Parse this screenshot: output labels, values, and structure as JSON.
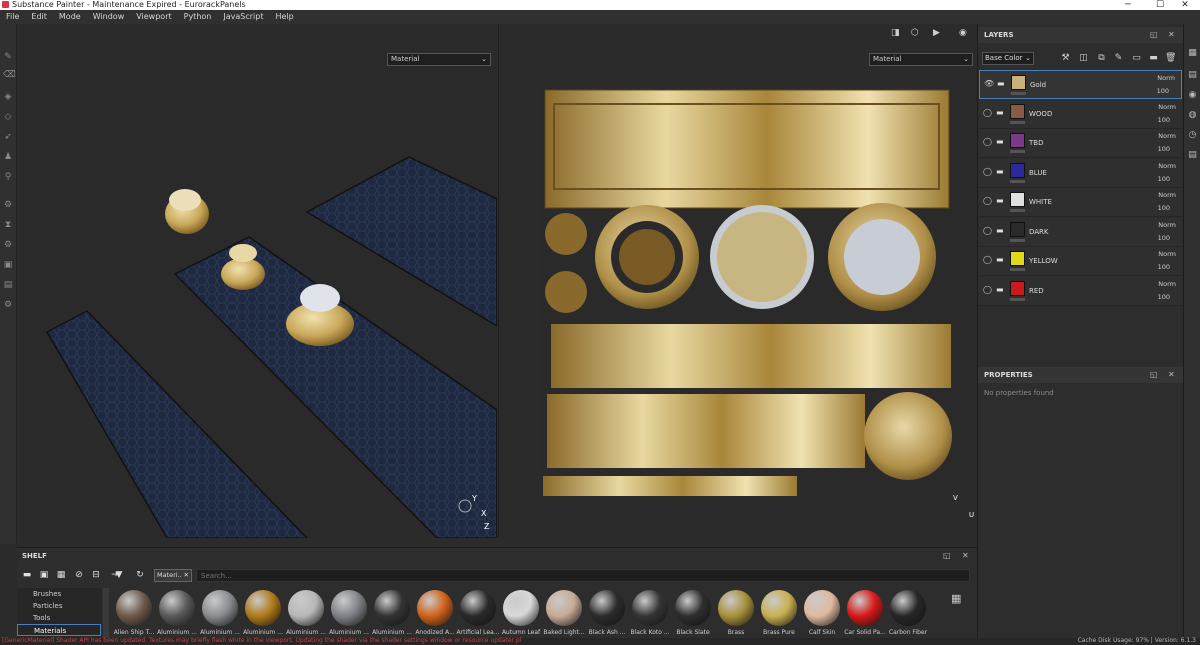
{
  "window": {
    "title": "Substance Painter - Maintenance Expired - EurorackPanels"
  },
  "menu": [
    "File",
    "Edit",
    "Mode",
    "Window",
    "Viewport",
    "Python",
    "JavaScript",
    "Help"
  ],
  "viewport3d": {
    "display_select": "Material",
    "axes": {
      "y": "Y",
      "x": "X",
      "z": "Z"
    }
  },
  "viewport2d": {
    "display_select": "Material",
    "axes": {
      "v": "V",
      "u": "U"
    }
  },
  "layers": {
    "title": "LAYERS",
    "channel": "Base Color",
    "items": [
      {
        "name": "Gold",
        "blend": "Norm",
        "opacity": "100",
        "color": "#c9b27a",
        "selected": true
      },
      {
        "name": "WOOD",
        "blend": "Norm",
        "opacity": "100",
        "color": "#8a5a44"
      },
      {
        "name": "TBD",
        "blend": "Norm",
        "opacity": "100",
        "color": "#7a3a86"
      },
      {
        "name": "BLUE",
        "blend": "Norm",
        "opacity": "100",
        "color": "#2a2a9a"
      },
      {
        "name": "WHITE",
        "blend": "Norm",
        "opacity": "100",
        "color": "#e0e0e0"
      },
      {
        "name": "DARK",
        "blend": "Norm",
        "opacity": "100",
        "color": "#2a2a2a"
      },
      {
        "name": "YELLOW",
        "blend": "Norm",
        "opacity": "100",
        "color": "#e2d81a"
      },
      {
        "name": "RED",
        "blend": "Norm",
        "opacity": "100",
        "color": "#cc1a1a"
      }
    ]
  },
  "properties": {
    "title": "PROPERTIES",
    "empty": "No properties found"
  },
  "shelf": {
    "title": "SHELF",
    "filter_chip": "Materi..",
    "search_placeholder": "Search...",
    "categories": [
      "Brushes",
      "Particles",
      "Tools",
      "Materials"
    ],
    "active_category": "Materials",
    "materials": [
      {
        "label": "Alien Ship T...",
        "color": "#6e5a4a"
      },
      {
        "label": "Aluminium ...",
        "color": "#5a5a5a"
      },
      {
        "label": "Aluminium ...",
        "color": "#8a8c90"
      },
      {
        "label": "Aluminium ...",
        "color": "#b07a18"
      },
      {
        "label": "Aluminium ...",
        "color": "#b8b8b8"
      },
      {
        "label": "Aluminium ...",
        "color": "#7e8288"
      },
      {
        "label": "Aluminium ...",
        "color": "#333333"
      },
      {
        "label": "Anodized A...",
        "color": "#d0621a"
      },
      {
        "label": "Artificial Lea...",
        "color": "#2a2a2a"
      },
      {
        "label": "Autumn Leaf",
        "color": "#d8d8d8"
      },
      {
        "label": "Baked Light...",
        "color": "#c8aa96"
      },
      {
        "label": "Black Ash ...",
        "color": "#2c2c2c"
      },
      {
        "label": "Black Koto ...",
        "color": "#353535"
      },
      {
        "label": "Black Slate",
        "color": "#2e2e2e"
      },
      {
        "label": "Brass",
        "color": "#a8903a"
      },
      {
        "label": "Brass Pure",
        "color": "#c8b050"
      },
      {
        "label": "Calf Skin",
        "color": "#e0b8a0"
      },
      {
        "label": "Car Solid Pa...",
        "color": "#d81818"
      },
      {
        "label": "Carbon Fiber",
        "color": "#262626"
      }
    ]
  },
  "status": {
    "message": "[GenericMaterial] Shader API has been updated. Textures may briefly flash white in the viewport. Updating the shader via the shader settings window or resource updater pl",
    "cache": "Cache Disk Usage:   97% | Version: 6.1.3"
  },
  "colors": {
    "accent": "#4a80b8",
    "error": "#d04040",
    "gold": "#c9a85a",
    "dark_panel": "#1f2a3e"
  }
}
